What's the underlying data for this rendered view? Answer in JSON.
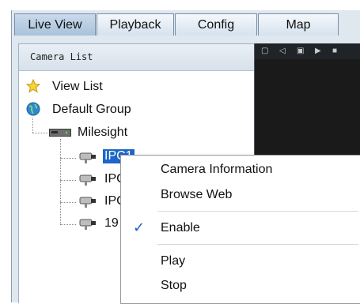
{
  "tabs": [
    {
      "label": "Live View",
      "active": true
    },
    {
      "label": "Playback",
      "active": false
    },
    {
      "label": "Config",
      "active": false
    },
    {
      "label": "Map",
      "active": false
    }
  ],
  "panel": {
    "title": "Camera List"
  },
  "tree": {
    "view_list": "View List",
    "default_group": "Default Group",
    "nvr": "Milesight",
    "cameras": [
      "IPC1",
      "IPC",
      "IPC",
      "19"
    ]
  },
  "context_menu": {
    "items": [
      "Camera Information",
      "Browse Web",
      "Enable",
      "Play",
      "Stop"
    ],
    "checked": "Enable"
  },
  "colors": {
    "selection": "#1e66c8",
    "check": "#1b5fbf",
    "frame": "#dfe7ef"
  },
  "icons": [
    "star-icon",
    "globe-icon",
    "nvr-icon",
    "camera-icon",
    "checkmark-icon"
  ]
}
